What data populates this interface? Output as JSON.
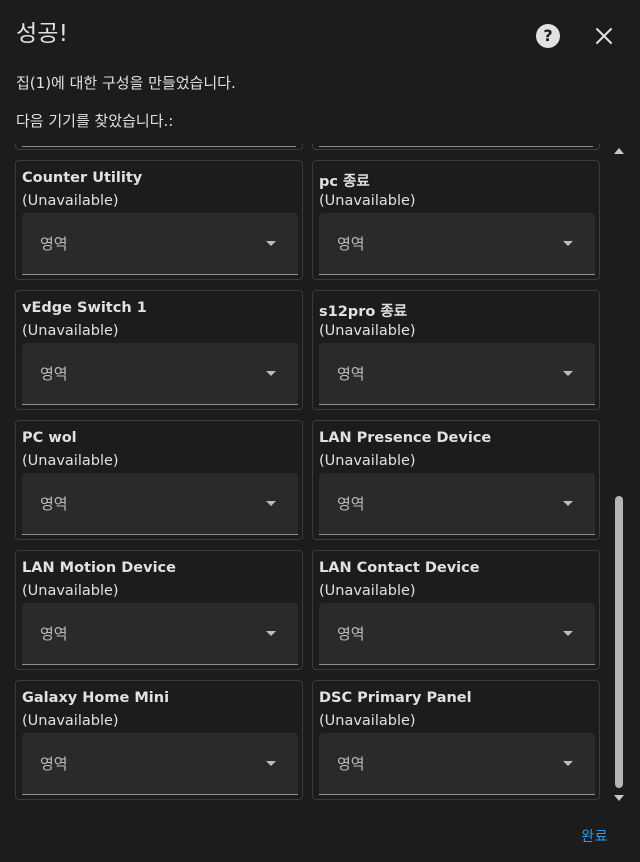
{
  "dialog": {
    "title": "성공!",
    "message1": "집(1)에 대한 구성을 만들었습니다.",
    "message2": "다음 기기를 찾았습니다.:",
    "done_label": "완료",
    "accent_color": "#2b9af3"
  },
  "icons": {
    "help": "help-circle-icon",
    "close": "close-icon",
    "dropdown": "chevron-down-icon"
  },
  "devices": [
    {
      "name": "Counter Utility",
      "status": "(Unavailable)",
      "area_placeholder": "영역"
    },
    {
      "name": "pc 종료",
      "status": "(Unavailable)",
      "area_placeholder": "영역"
    },
    {
      "name": "vEdge Switch 1",
      "status": "(Unavailable)",
      "area_placeholder": "영역"
    },
    {
      "name": "s12pro 종료",
      "status": "(Unavailable)",
      "area_placeholder": "영역"
    },
    {
      "name": "PC wol",
      "status": "(Unavailable)",
      "area_placeholder": "영역"
    },
    {
      "name": "LAN Presence Device",
      "status": "(Unavailable)",
      "area_placeholder": "영역"
    },
    {
      "name": "LAN Motion Device",
      "status": "(Unavailable)",
      "area_placeholder": "영역"
    },
    {
      "name": "LAN Contact Device",
      "status": "(Unavailable)",
      "area_placeholder": "영역"
    },
    {
      "name": "Galaxy Home Mini",
      "status": "(Unavailable)",
      "area_placeholder": "영역"
    },
    {
      "name": "DSC Primary Panel",
      "status": "(Unavailable)",
      "area_placeholder": "영역"
    }
  ]
}
